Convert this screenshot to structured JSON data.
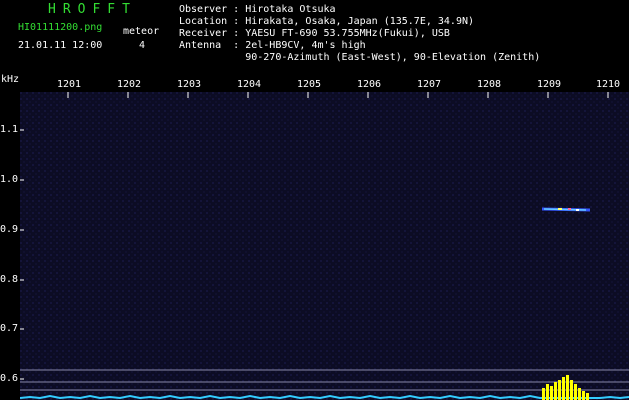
{
  "header": {
    "app_title": "HROFFT",
    "file_name": "HI01111200.png",
    "timestamp": "21.01.11 12:00",
    "meteor_label": "meteor",
    "meteor_count": "4"
  },
  "station_info": {
    "observer": "Observer : Hirotaka Otsuka",
    "location": "Location : Hirakata, Osaka, Japan (135.7E, 34.9N)",
    "receiver": "Receiver : YAESU FT-690 53.755MHz(Fukui), USB",
    "antenna": "Antenna  : 2el-HB9CV, 4m's high",
    "antenna_detail": "           90-270-Azimuth (East-West), 90-Elevation (Zenith)"
  },
  "spectrogram": {
    "y_unit": "kHz",
    "x_ticks": [
      "1201",
      "1202",
      "1203",
      "1204",
      "1205",
      "1206",
      "1207",
      "1208",
      "1209",
      "1210"
    ],
    "y_ticks": [
      "1.1",
      "1.0",
      "0.9",
      "0.8",
      "0.7",
      "0.6"
    ],
    "colors": {
      "background": "#0c0c24",
      "tick": "#ffffff",
      "meteor_echo": "#66ccff",
      "baseline": "#33ccff",
      "carrier": "#ffff00"
    }
  }
}
